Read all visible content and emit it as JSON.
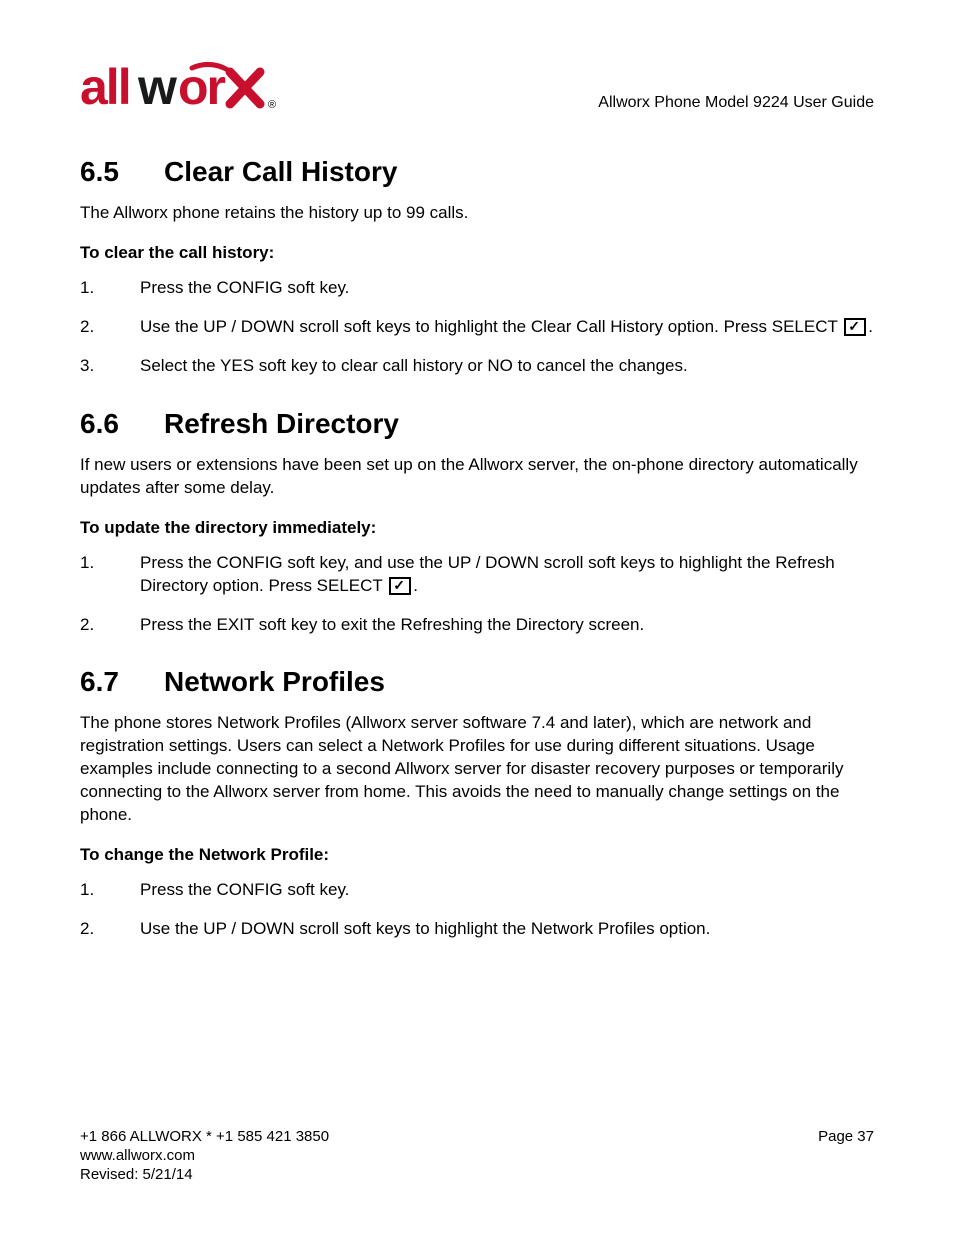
{
  "header": {
    "logo_text": "allworx",
    "doc_title": "Allworx Phone Model 9224 User Guide"
  },
  "sections": {
    "s65": {
      "num": "6.5",
      "title": "Clear Call History",
      "intro": "The Allworx phone retains the history up to 99 calls.",
      "lead": "To clear the call history:",
      "steps": {
        "s1": "Press the CONFIG soft key.",
        "s2a": "Use the UP / DOWN scroll soft keys to highlight the Clear Call History option. Press SELECT ",
        "s2b": ".",
        "s3": "Select the YES soft key to clear call history or NO to cancel the changes."
      }
    },
    "s66": {
      "num": "6.6",
      "title": "Refresh Directory",
      "intro": "If new users or extensions have been set up on the Allworx server, the on-phone directory automatically updates after some delay.",
      "lead": "To update the directory immediately:",
      "steps": {
        "s1a": "Press the CONFIG soft key, and use the UP / DOWN scroll soft keys to highlight the Refresh Directory option. Press SELECT ",
        "s1b": ".",
        "s2": "Press the EXIT soft key to exit the Refreshing the Directory screen."
      }
    },
    "s67": {
      "num": "6.7",
      "title": "Network Profiles",
      "intro": "The phone stores Network Profiles (Allworx server software 7.4 and later), which are network and registration settings. Users can select a Network Profiles for use during different situations. Usage examples include connecting to a second Allworx server for disaster recovery purposes or temporarily connecting to the Allworx server from home. This avoids the need to manually change settings on the phone.",
      "lead": "To change the Network Profile:",
      "steps": {
        "s1": "Press the CONFIG soft key.",
        "s2": "Use the UP / DOWN scroll soft keys to highlight the Network Profiles option."
      }
    }
  },
  "footer": {
    "phone_line": "+1 866 ALLWORX * +1 585 421 3850",
    "url": "www.allworx.com",
    "revised": "Revised: 5/21/14",
    "page": "Page 37"
  }
}
